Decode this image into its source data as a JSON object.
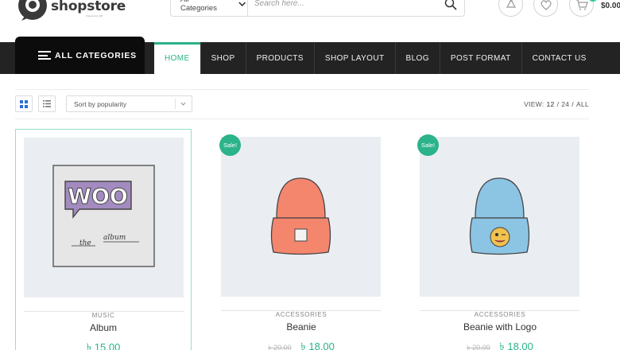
{
  "brand": {
    "name": "shopstore",
    "tagline": "Powered by WP"
  },
  "search": {
    "category": "All Categories",
    "placeholder": "Search here..."
  },
  "header_icons": [
    "recycle-icon",
    "heart-icon",
    "cart-icon"
  ],
  "cart": {
    "total": "$0.00"
  },
  "all_categories": {
    "label": "ALL CATEGORIES"
  },
  "menu": [
    {
      "label": "HOME",
      "active": true
    },
    {
      "label": "SHOP"
    },
    {
      "label": "PRODUCTS"
    },
    {
      "label": "SHOP LAYOUT"
    },
    {
      "label": "BLOG"
    },
    {
      "label": "POST FORMAT"
    },
    {
      "label": "CONTACT US"
    }
  ],
  "toolbar": {
    "sort": "Sort by popularity",
    "view_label": "VIEW:",
    "view_options": [
      "12",
      "/",
      "24",
      "/",
      "ALL"
    ]
  },
  "products": [
    {
      "category": "MUSIC",
      "title": "Album",
      "price": "৳ 15.00",
      "old_price": "",
      "sale": false,
      "image": "woo-album"
    },
    {
      "category": "ACCESSORIES",
      "title": "Beanie",
      "price": "৳ 18.00",
      "old_price": "৳ 20.00",
      "sale": true,
      "sale_label": "Sale!",
      "image": "beanie-orange"
    },
    {
      "category": "ACCESSORIES",
      "title": "Beanie with Logo",
      "price": "৳ 18.00",
      "old_price": "৳ 20.00",
      "sale": true,
      "sale_label": "Sale!",
      "image": "beanie-blue-logo"
    }
  ],
  "colors": {
    "accent": "#2bb38a",
    "nav_bg": "#232323",
    "all_cat_bg": "#0c0c0c"
  }
}
